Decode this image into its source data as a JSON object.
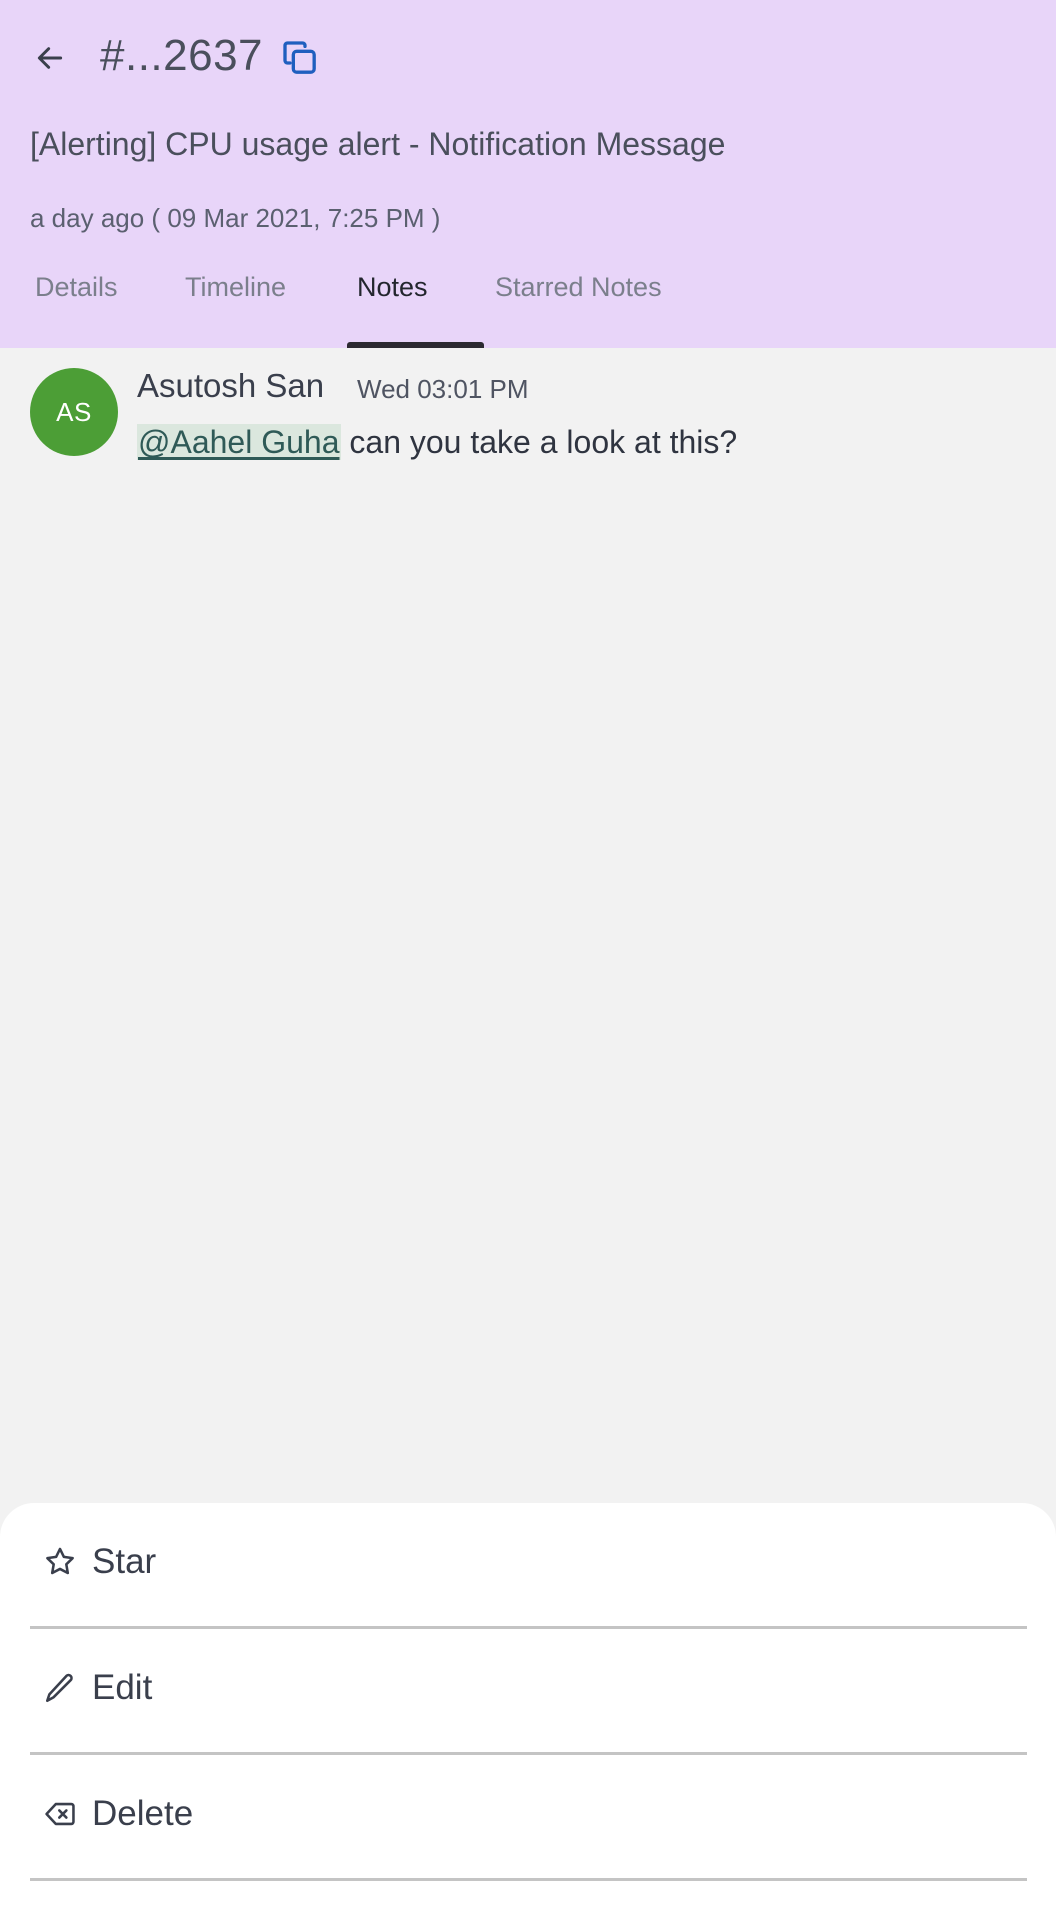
{
  "header": {
    "incident_id": "#...2637",
    "title": "[Alerting] CPU usage alert - Notification Message",
    "time": "a day ago ( 09 Mar 2021, 7:25 PM )",
    "back_icon": "arrow-left-icon",
    "copy_icon": "copy-icon",
    "copy_icon_color": "#1f5fbf",
    "background_color": "#e8d5f9"
  },
  "tabs": {
    "items": [
      {
        "label": "Details"
      },
      {
        "label": "Timeline"
      },
      {
        "label": "Notes"
      },
      {
        "label": "Starred Notes"
      }
    ],
    "active": "Notes"
  },
  "notes": [
    {
      "avatar_initials": "AS",
      "avatar_color": "#4c9e36",
      "author": "Asutosh San",
      "time": "Wed 03:01 PM",
      "mention": "@Aahel Guha",
      "text": "can you take a look at this?"
    }
  ],
  "action_sheet": {
    "star": {
      "label": "Star",
      "icon": "star-icon"
    },
    "edit": {
      "label": "Edit",
      "icon": "pencil-icon"
    },
    "delete": {
      "label": "Delete",
      "icon": "backspace-icon"
    }
  }
}
